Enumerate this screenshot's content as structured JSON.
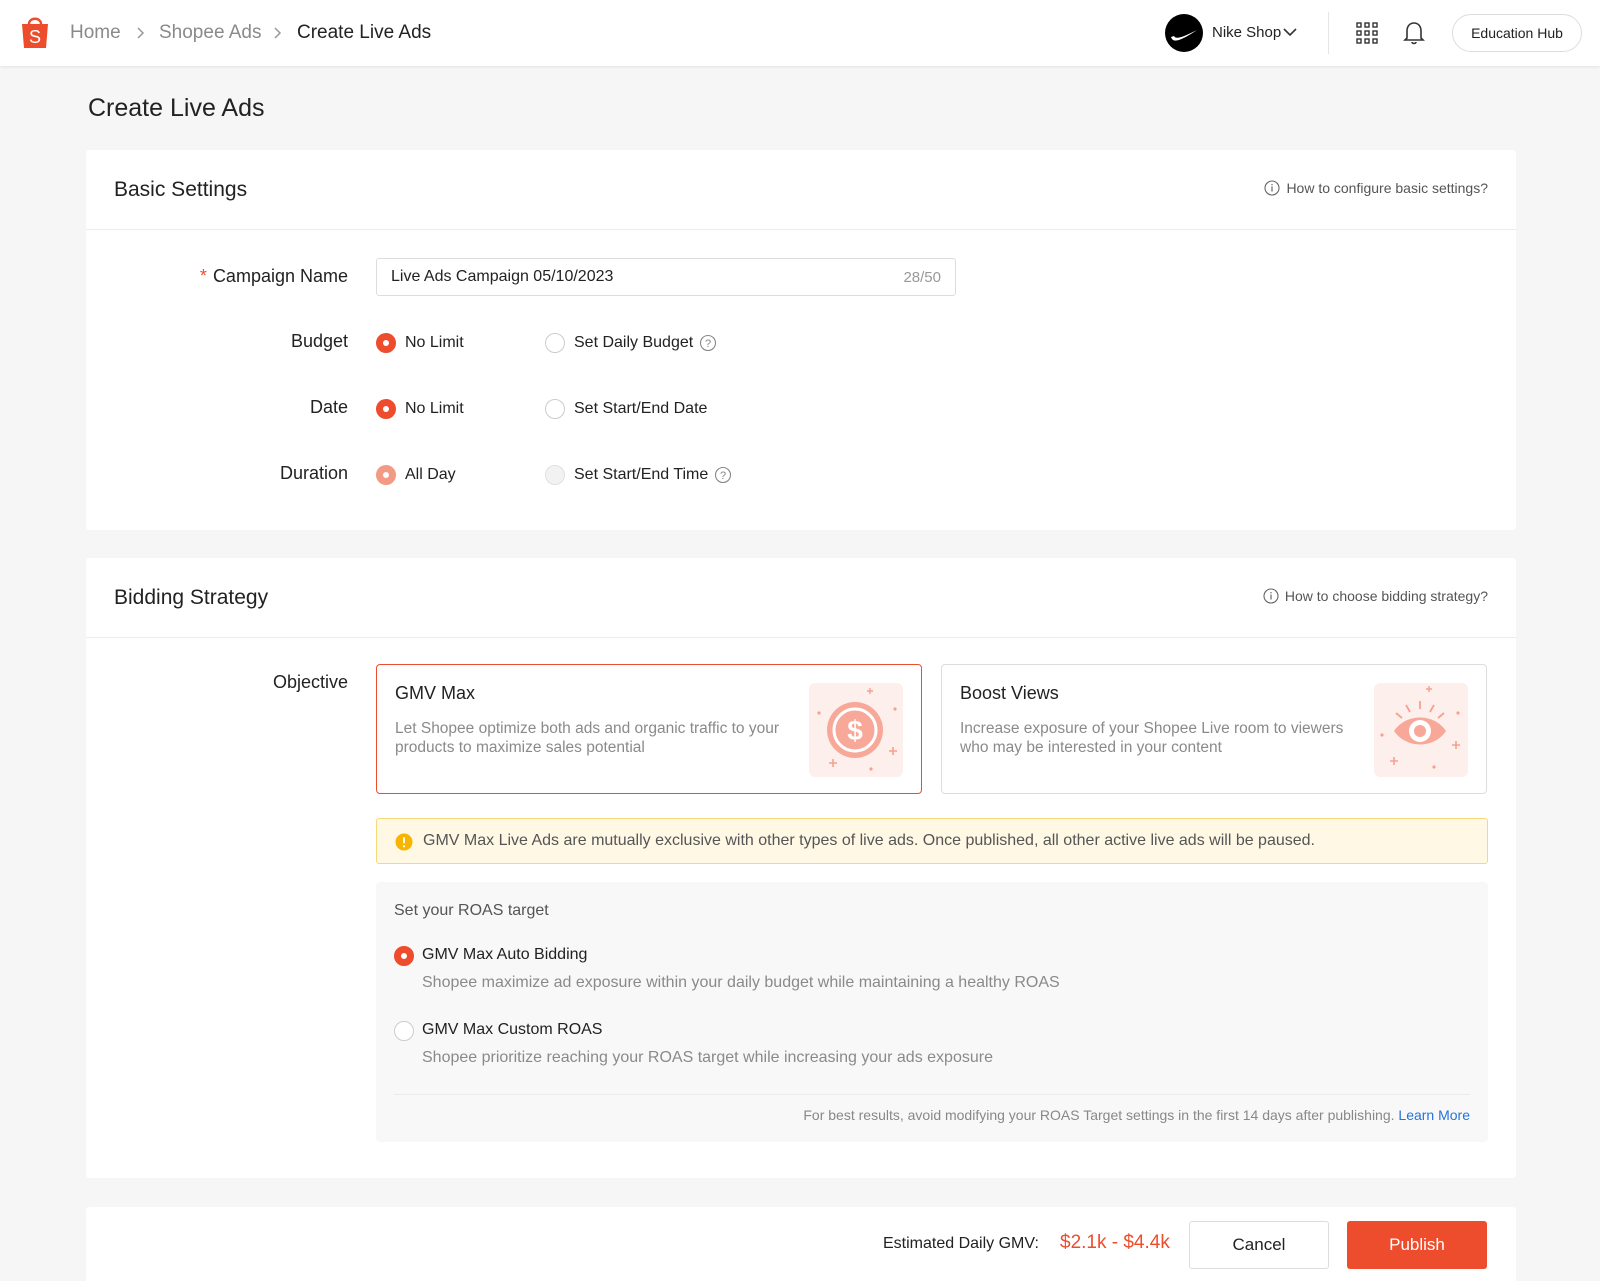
{
  "header": {
    "breadcrumbs": [
      "Home",
      "Shopee Ads",
      "Create Live Ads"
    ],
    "shop_name": "Nike Shop",
    "education_hub": "Education Hub"
  },
  "page": {
    "title": "Create Live Ads"
  },
  "basic_settings": {
    "title": "Basic Settings",
    "help": "How to configure basic settings?",
    "campaign_name": {
      "label": "Campaign Name",
      "value": "Live Ads Campaign 05/10/2023",
      "count": "28/50"
    },
    "budget": {
      "label": "Budget",
      "options": [
        "No Limit",
        "Set Daily Budget"
      ],
      "selected": "No Limit"
    },
    "date": {
      "label": "Date",
      "options": [
        "No Limit",
        "Set Start/End Date"
      ],
      "selected": "No Limit"
    },
    "duration": {
      "label": "Duration",
      "options": [
        "All Day",
        "Set Start/End Time"
      ],
      "selected": "All Day"
    }
  },
  "bidding": {
    "title": "Bidding Strategy",
    "help": "How to choose bidding strategy?",
    "objective_label": "Objective",
    "objectives": [
      {
        "title": "GMV Max",
        "desc": "Let Shopee optimize both ads and organic traffic to your products to maximize sales potential",
        "icon": "dollar-coin-icon",
        "selected": true
      },
      {
        "title": "Boost Views",
        "desc": "Increase exposure of your Shopee Live room to viewers who may be interested in your content",
        "icon": "eye-icon",
        "selected": false
      }
    ],
    "warning": "GMV Max Live Ads are mutually exclusive with other types of live ads. Once published, all other active live ads will be paused.",
    "roas": {
      "title": "Set your ROAS target",
      "options": [
        {
          "title": "GMV Max Auto Bidding",
          "desc": "Shopee maximize ad exposure within your daily budget while maintaining a healthy ROAS",
          "selected": true
        },
        {
          "title": "GMV Max Custom ROAS",
          "desc": "Shopee prioritize reaching your ROAS target while increasing your ads exposure",
          "selected": false
        }
      ],
      "note": "For best results, avoid modifying your ROAS Target settings in the first 14 days after publishing.",
      "learn_more": "Learn More"
    }
  },
  "footer": {
    "gmv_label": "Estimated Daily GMV:",
    "gmv_value": "$2.1k - $4.4k",
    "cancel": "Cancel",
    "publish": "Publish"
  },
  "colors": {
    "brand": "#ee4d2d",
    "link": "#2673dd",
    "warning_bg": "#fff8e5"
  }
}
